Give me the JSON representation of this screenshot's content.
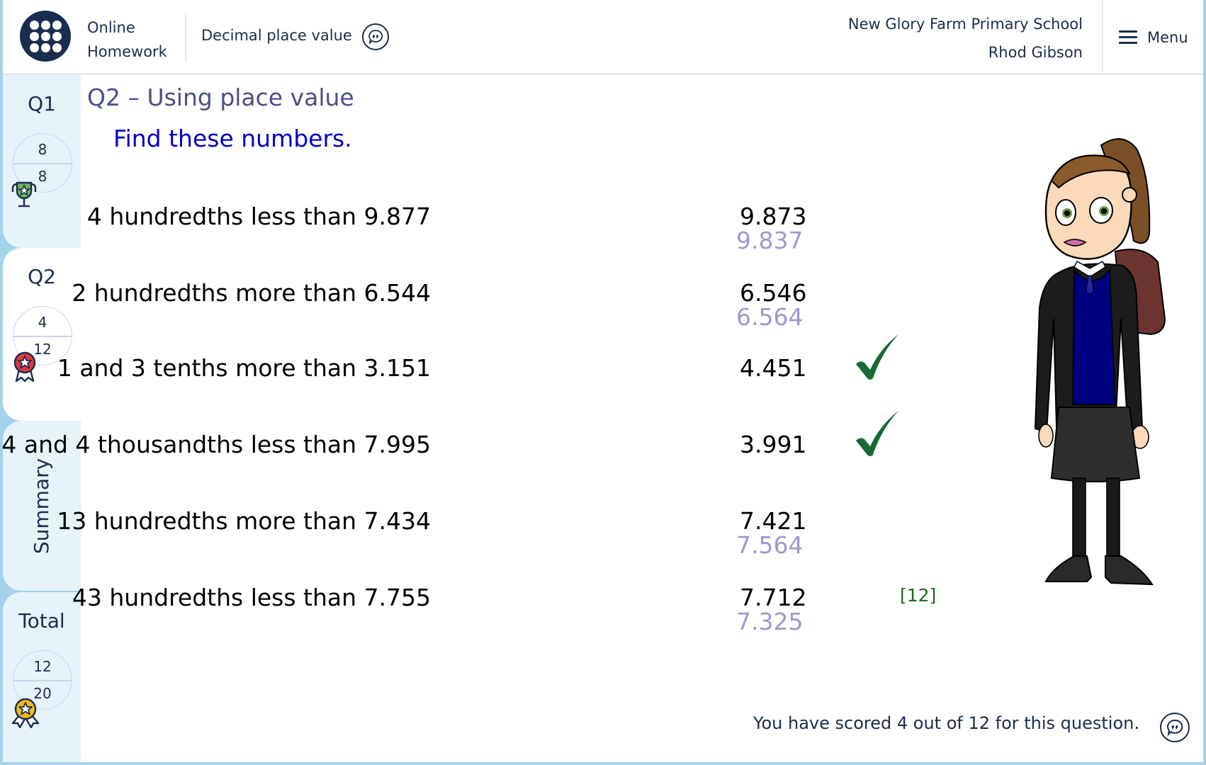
{
  "header": {
    "app_name_line1": "Online",
    "app_name_line2": "Homework",
    "topic": "Decimal place value",
    "topic_icon": "speech-bubble-quote-icon",
    "school": "New Glory Farm Primary School",
    "user": "Rhod Gibson",
    "menu_label": "Menu",
    "menu_icon": "hamburger-icon"
  },
  "sidebar": {
    "tabs": [
      {
        "label": "Q1",
        "score": "8",
        "max": "8",
        "badge": "trophy-icon",
        "badge_color": "#6db34f",
        "active": false
      },
      {
        "label": "Q2",
        "score": "4",
        "max": "12",
        "badge": "rosette-icon",
        "badge_color": "#e2363f",
        "active": true
      },
      {
        "label": "Summary",
        "active": false
      },
      {
        "label": "Total",
        "score": "12",
        "max": "20",
        "badge": "rosette-icon",
        "badge_color": "#f5b915",
        "active": false
      }
    ]
  },
  "question": {
    "title": "Q2 – Using place value",
    "instruction": "Find these numbers.",
    "rows": [
      {
        "prompt": "4 hundredths less than 9.877",
        "answer": "9.873",
        "correct_answer": "9.837",
        "result": "wrong"
      },
      {
        "prompt": "2 hundredths more than 6.544",
        "answer": "6.546",
        "correct_answer": "6.564",
        "result": "wrong"
      },
      {
        "prompt": "1 and 3 tenths more than 3.151",
        "answer": "4.451",
        "correct_answer": "",
        "result": "correct"
      },
      {
        "prompt": "4 and 4 thousandths less than 7.995",
        "answer": "3.991",
        "correct_answer": "",
        "result": "correct"
      },
      {
        "prompt": "13 hundredths more than 7.434",
        "answer": "7.421",
        "correct_answer": "7.564",
        "result": "wrong"
      },
      {
        "prompt": "43 hundredths less than 7.755",
        "answer": "7.712",
        "correct_answer": "7.325",
        "result": "wrong"
      }
    ],
    "marks_label": "[12]",
    "score_message": "You have scored 4 out of 12 for this question."
  },
  "colors": {
    "accent_border": "#a3d2ea",
    "navy": "#1b2d4f",
    "title": "#4a4f8a",
    "instruction": "#0000c8",
    "correction": "#9a9ad0",
    "check": "#156b33",
    "marks": "#1a6b1a"
  }
}
